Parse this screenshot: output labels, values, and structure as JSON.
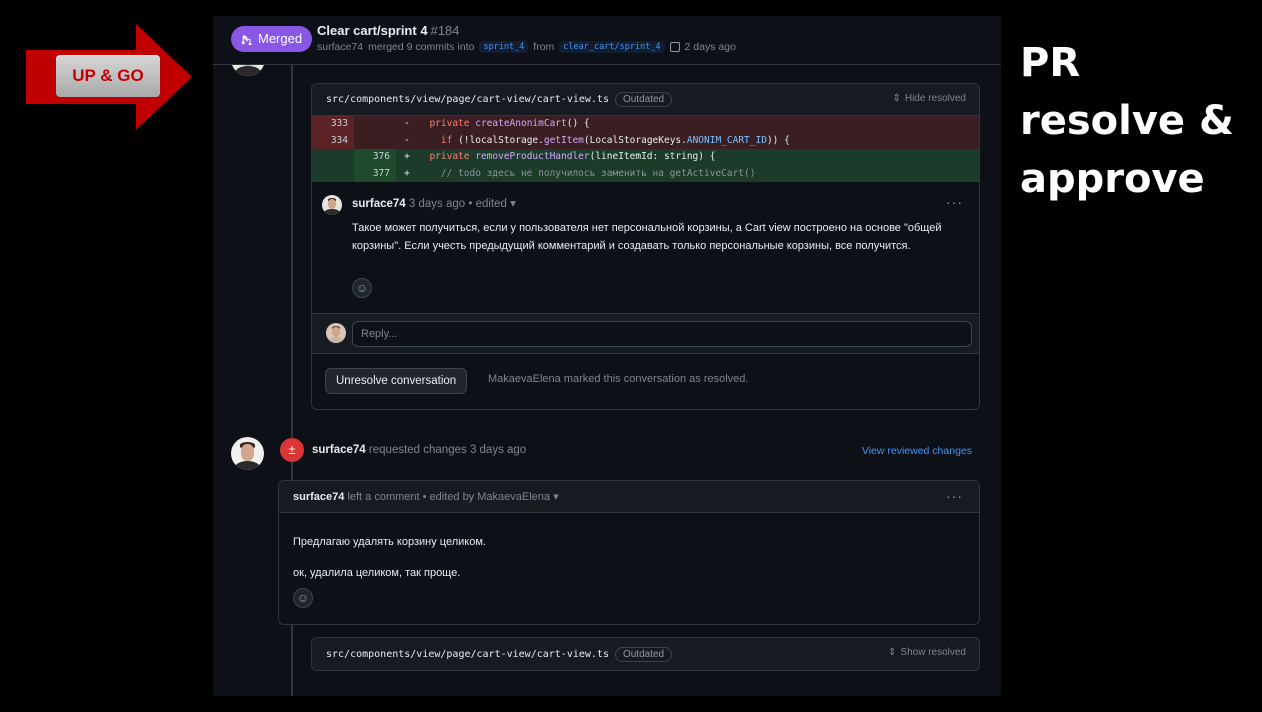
{
  "overlay": {
    "arrow_label": "UP & GO",
    "caption_lines": [
      "PR",
      "resolve &",
      "approve"
    ],
    "arrow_color": "#c00000"
  },
  "pr": {
    "status": "Merged",
    "title": "Clear cart/sprint 4",
    "number": "#184",
    "author": "surface74",
    "merged_text": "merged 9 commits into",
    "base_branch": "sprint_4",
    "from_text": "from",
    "head_branch": "clear_cart/sprint_4",
    "time": "2 days ago",
    "merged_color": "#8957e5"
  },
  "thread1": {
    "file_path": "src/components/view/page/cart-view/cart-view.ts",
    "outdated_label": "Outdated",
    "hide_resolved": "Hide resolved",
    "diff": [
      {
        "type": "del",
        "old": "333",
        "new": "",
        "sign": "-",
        "indent": "  ",
        "t1": "private ",
        "t2": "createAnonimCart",
        "t3": "() {",
        "t4": "",
        "t5": ""
      },
      {
        "type": "del",
        "old": "334",
        "new": "",
        "sign": "-",
        "indent": "    ",
        "t1": "if ",
        "t2": "(!localStorage.",
        "t3": "getItem",
        "t4": "(LocalStorageKeys.",
        "t5": "ANONIM_CART_ID",
        "t6": ")) {"
      },
      {
        "type": "add",
        "old": "",
        "new": "376",
        "sign": "+",
        "indent": "  ",
        "t1": "private ",
        "t2": "removeProductHandler",
        "t3": "(lineItemId: string) {"
      },
      {
        "type": "add",
        "old": "",
        "new": "377",
        "sign": "+",
        "indent": "    ",
        "comment": "// todo здесь не получилось заменить на getActiveCart()"
      }
    ],
    "comment": {
      "author": "surface74",
      "meta": "3 days ago • edited",
      "more": "···",
      "body": "Такое может получиться, если у пользователя нет персональной корзины, а Cart view построено на основе \"общей корзины\". Если учесть предыдущий комментарий и создавать только персональные корзины, все получится."
    },
    "reply_placeholder": "Reply...",
    "unresolve_button": "Unresolve conversation",
    "resolved_by": "MakaevaElena marked this conversation as resolved."
  },
  "review": {
    "author": "surface74",
    "action": "requested changes 3 days ago",
    "view_changes": "View reviewed changes",
    "comment": {
      "author": "surface74",
      "meta": "left a comment • edited by MakaevaElena",
      "more": "···",
      "line1": "Предлагаю удалять корзину целиком.",
      "line2": "ок, удалила целиком, так проще."
    }
  },
  "thread2": {
    "file_path": "src/components/view/page/cart-view/cart-view.ts",
    "outdated_label": "Outdated",
    "show_resolved": "Show resolved"
  }
}
